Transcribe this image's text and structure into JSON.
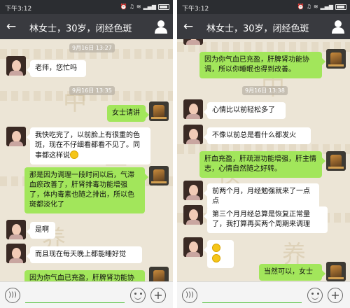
{
  "status": {
    "time": "下午3:12",
    "icons": [
      "alarm-icon",
      "headphones-icon",
      "wifi-icon",
      "signal-icon",
      "battery-icon"
    ]
  },
  "header": {
    "title": "林女士，30岁，闭经色斑",
    "back_icon": "back-arrow-icon",
    "profile_icon": "person-icon"
  },
  "colors": {
    "titlebar": "#393a3f",
    "statusbar": "#2b2d31",
    "bubble_out": "#a2e65b",
    "bubble_in": "#ffffff",
    "chat_bg": "#ece5d6",
    "input_accent": "#4fbf3a"
  },
  "left_screen": {
    "timestamps": [
      "9月16日 13:27",
      "9月16日 13:35"
    ],
    "messages": [
      {
        "side": "in",
        "avatar": "customer-avatar",
        "text": "老师，您忙吗"
      },
      {
        "side": "out",
        "avatar": "consultant-avatar",
        "text": "女士请讲"
      },
      {
        "side": "in",
        "avatar": "customer-avatar",
        "text": "我快吃完了，以前脸上有很重的色斑，现在不仔细看都看不见了。同事都这样说",
        "emoji": "smile-emoji"
      },
      {
        "side": "out",
        "avatar": "consultant-avatar",
        "text": "那是因为调理一段时间以后，气滞血瘀改善了，肝肾排毒功能增强了，体内毒素也随之排出，所以色斑都淡化了"
      },
      {
        "side": "in",
        "avatar": "customer-avatar",
        "text": "是啊"
      },
      {
        "side": "in",
        "avatar": "customer-avatar",
        "text": "而且现在每天晚上都能睡好觉"
      },
      {
        "side": "out",
        "avatar": "consultant-avatar",
        "text": "因为你气血已充盈，肝脾肾功能协"
      }
    ]
  },
  "right_screen": {
    "timestamps": [
      "9月16日 13:38"
    ],
    "messages": [
      {
        "side": "out",
        "avatar": "consultant-avatar",
        "text": "因为你气血已充盈，肝脾肾功能协调，所以你睡眠也得到改善。"
      },
      {
        "side": "in",
        "avatar": "customer-avatar",
        "text": "心情比以前轻松多了"
      },
      {
        "side": "in",
        "avatar": "customer-avatar",
        "text": "不像以前总是看什么都发火"
      },
      {
        "side": "out",
        "avatar": "consultant-avatar",
        "text": "肝血充盈，肝疏泄功能增强，肝主情志，心情自然随之好转。"
      },
      {
        "side": "in",
        "avatar": "customer-avatar",
        "text": "前两个月，月经勉强就来了一点点"
      },
      {
        "side": "in",
        "avatar": "customer-avatar",
        "text": "第三个月月经总算是恢复正常量了，我打算再买两个周期来调理"
      },
      {
        "side": "in",
        "avatar": "customer-avatar",
        "text": "",
        "emoji_count": 2
      },
      {
        "side": "out",
        "avatar": "consultant-avatar",
        "text": "当然可以，女士"
      }
    ]
  },
  "input_bar": {
    "voice_icon": "voice-icon",
    "emoji_icon": "emoji-icon",
    "plus_icon": "plus-icon"
  }
}
